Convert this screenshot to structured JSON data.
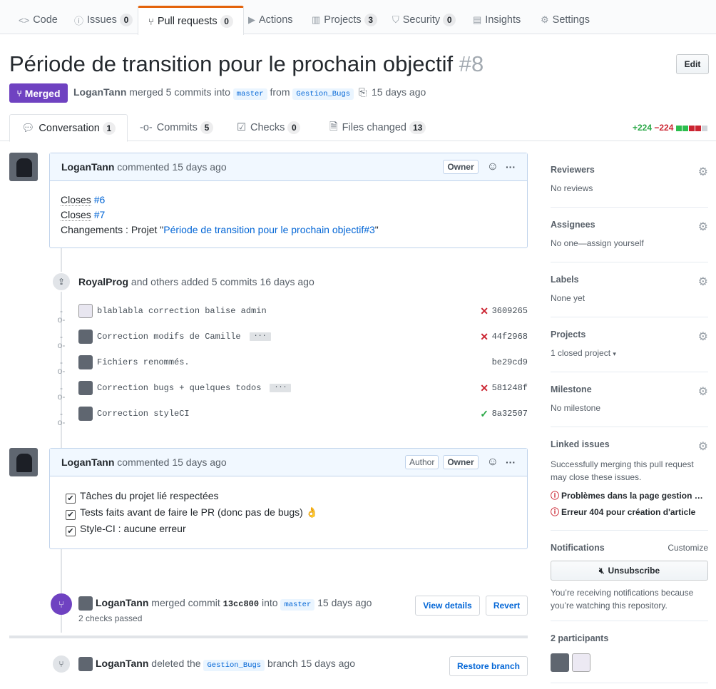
{
  "repo_nav": {
    "tabs": [
      {
        "label": "Code",
        "icon": "code-icon",
        "count": null
      },
      {
        "label": "Issues",
        "icon": "issue-opened-icon",
        "count": "0"
      },
      {
        "label": "Pull requests",
        "icon": "git-pull-request-icon",
        "count": "0",
        "selected": true
      },
      {
        "label": "Actions",
        "icon": "play-icon",
        "count": null
      },
      {
        "label": "Projects",
        "icon": "project-icon",
        "count": "3"
      },
      {
        "label": "Security",
        "icon": "shield-icon",
        "count": "0"
      },
      {
        "label": "Insights",
        "icon": "graph-icon",
        "count": null
      },
      {
        "label": "Settings",
        "icon": "gear-icon",
        "count": null
      }
    ]
  },
  "pr": {
    "title": "Période de transition pour le prochain objectif",
    "number": "#8",
    "edit_label": "Edit",
    "state": "Merged",
    "author": "LoganTann",
    "merged_text": "merged 5 commits into",
    "base_branch": "master",
    "from_text": "from",
    "head_branch": "Gestion_Bugs",
    "time": "15 days ago"
  },
  "pr_tabs": [
    {
      "label": "Conversation",
      "count": "1",
      "icon": "comment-discussion-icon"
    },
    {
      "label": "Commits",
      "count": "5",
      "icon": "git-commit-icon"
    },
    {
      "label": "Checks",
      "count": "0",
      "icon": "checklist-icon"
    },
    {
      "label": "Files changed",
      "count": "13",
      "icon": "file-diff-icon"
    }
  ],
  "diffstat": {
    "additions": "+224",
    "deletions": "−224"
  },
  "comment1": {
    "author": "LoganTann",
    "action": "commented",
    "time": "15 days ago",
    "badge": "Owner",
    "lines": [
      {
        "prefix": "Closes",
        "link": "#6"
      },
      {
        "prefix": "Closes",
        "link": "#7"
      }
    ],
    "changes_prefix": "Changements : Projet \"",
    "changes_link": "Période de transition pour le prochain objectif#3",
    "changes_suffix": "\""
  },
  "commits_event": {
    "author": "RoyalProg",
    "text": "and others added 5 commits",
    "time": "16 days ago",
    "commits": [
      {
        "message": "blablabla correction balise admin",
        "sha": "3609265",
        "status": "fail",
        "ellipsis": false
      },
      {
        "message": "Correction modifs de Camille",
        "sha": "44f2968",
        "status": "fail",
        "ellipsis": true
      },
      {
        "message": "Fichiers renommés.",
        "sha": "be29cd9",
        "status": "none",
        "ellipsis": false
      },
      {
        "message": "Correction bugs + quelques todos",
        "sha": "581248f",
        "status": "fail",
        "ellipsis": true
      },
      {
        "message": "Correction styleCI",
        "sha": "8a32507",
        "status": "success",
        "ellipsis": false
      }
    ]
  },
  "comment2": {
    "author": "LoganTann",
    "action": "commented",
    "time": "15 days ago",
    "badge_author": "Author",
    "badge_owner": "Owner",
    "tasks": [
      "Tâches du projet lié respectées",
      "Tests faits avant de faire le PR (donc pas de bugs) 👌",
      "Style-CI : aucune erreur"
    ]
  },
  "merge_event": {
    "author": "LoganTann",
    "text": "merged commit",
    "sha": "13cc800",
    "into": "into",
    "branch": "master",
    "time": "15 days ago",
    "checks": "2 checks passed",
    "view_details": "View details",
    "revert": "Revert"
  },
  "delete_event": {
    "author": "LoganTann",
    "text": "deleted the",
    "branch": "Gestion_Bugs",
    "suffix": "branch",
    "time": "15 days ago",
    "restore": "Restore branch"
  },
  "sidebar": {
    "reviewers": {
      "title": "Reviewers",
      "value": "No reviews"
    },
    "assignees": {
      "title": "Assignees",
      "value": "No one—assign yourself"
    },
    "labels": {
      "title": "Labels",
      "value": "None yet"
    },
    "projects": {
      "title": "Projects",
      "value": "1 closed project"
    },
    "milestone": {
      "title": "Milestone",
      "value": "No milestone"
    },
    "linked": {
      "title": "Linked issues",
      "desc1": "Successfully merging this pull request",
      "desc2": "may close these issues.",
      "issues": [
        "Problèmes dans la page gestion …",
        "Erreur 404 pour création d'article"
      ]
    },
    "notifications": {
      "title": "Notifications",
      "customize": "Customize",
      "button": "Unsubscribe",
      "desc1": "You’re receiving notifications because",
      "desc2": "you’re watching this repository."
    },
    "participants": {
      "title": "2 participants"
    }
  },
  "colors": {
    "merged": "#6f42c1",
    "link": "#0366d6",
    "add": "#28a745",
    "del": "#cb2431"
  }
}
